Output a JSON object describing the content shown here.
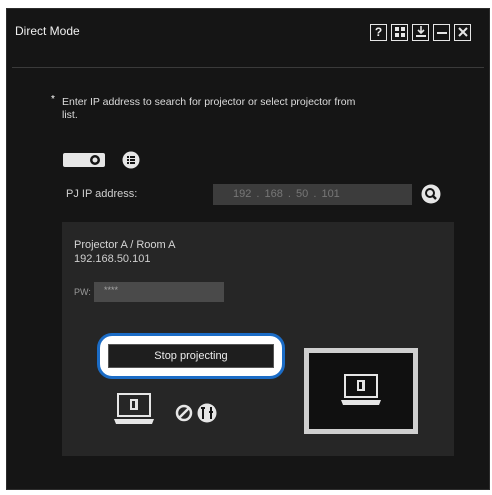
{
  "window": {
    "title": "Direct Mode",
    "controls": [
      {
        "name": "help-icon",
        "glyph": "?"
      },
      {
        "name": "grid-icon",
        "glyph": "grid"
      },
      {
        "name": "save-icon",
        "glyph": "save"
      },
      {
        "name": "minimize-icon",
        "glyph": "—"
      },
      {
        "name": "close-icon",
        "glyph": "✕"
      }
    ]
  },
  "instruction": {
    "bullet": "*",
    "text": "Enter IP address to search for projector or select projector from list."
  },
  "connection": {
    "ip_label": "PJ IP address:",
    "ip_value": "192 . 168 . 50 . 101"
  },
  "projector": {
    "name": "Projector A / Room A",
    "ip": "192.168.50.101",
    "pw_label": "PW:",
    "pw_value": "****",
    "stop_button_label": "Stop projecting"
  },
  "colors": {
    "window_bg": "#151515",
    "panel_bg": "#262626",
    "highlight": "#1b6cc6"
  }
}
